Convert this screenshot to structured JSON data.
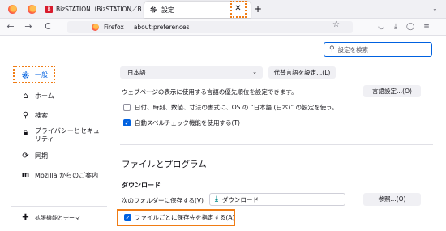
{
  "tabs": {
    "biz_label": "BizSTATION（BizSTATION／Bi",
    "active_label": "設定",
    "close_glyph": "✕",
    "new_tab_glyph": "+"
  },
  "nav": {
    "back": "←",
    "forward": "→",
    "reload": "C",
    "url_brand": "Firefox",
    "url": "about:preferences",
    "star": "☆"
  },
  "search": {
    "placeholder": "設定を検索"
  },
  "sidebar": {
    "items": [
      {
        "label": "一般",
        "icon": "gear-icon"
      },
      {
        "label": "ホーム",
        "icon": "home-icon"
      },
      {
        "label": "検索",
        "icon": "search-icon"
      },
      {
        "label": "プライバシーとセキュリティ",
        "icon": "lock-icon"
      },
      {
        "label": "同期",
        "icon": "sync-icon"
      },
      {
        "label": "Mozilla からのご案内",
        "icon": "mozilla-icon"
      },
      {
        "label": "拡張機能とテーマ",
        "icon": "puzzle-icon"
      }
    ]
  },
  "language": {
    "selected": "日本語",
    "alt_button": "代替言語を設定...(L)",
    "desc": "ウェブページの表示に使用する言語の優先順位を設定できます。",
    "lang_button": "言語設定...(O)",
    "os_format_label": "日付、時刻、数値、寸法の書式に、OS の “日本語 (日本)” の設定を使う。",
    "os_format_checked": false,
    "spellcheck_label": "自動スペルチェック機能を使用する(T)",
    "spellcheck_checked": true
  },
  "files": {
    "section_title": "ファイルとプログラム",
    "download_title": "ダウンロード",
    "save_to_label": "次のフォルダーに保存する(V)",
    "folder": "ダウンロード",
    "browse_button": "参照...(O)",
    "ask_label": "ファイルごとに保存先を指定する(A)",
    "ask_checked": true
  },
  "colors": {
    "accent": "#0061e0",
    "highlight": "#f07c14"
  }
}
